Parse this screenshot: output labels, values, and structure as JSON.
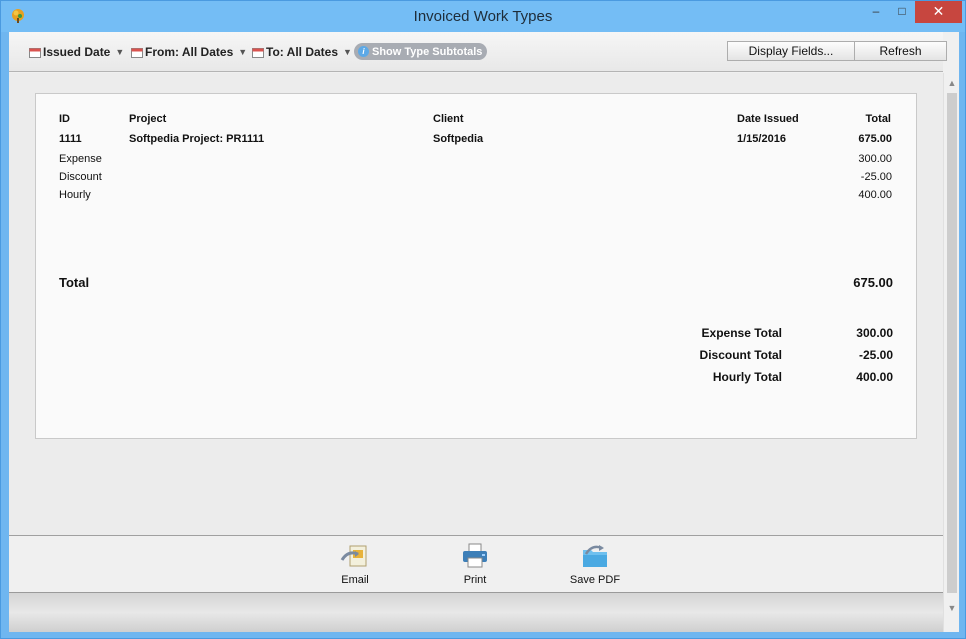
{
  "window": {
    "title": "Invoiced Work Types",
    "minimize": "–",
    "maximize": "□",
    "close": "✕"
  },
  "toolbar": {
    "filters": [
      {
        "label": "Issued Date",
        "icon": "calendar-icon"
      },
      {
        "label": "From: All Dates",
        "icon": "calendar-icon"
      },
      {
        "label": "To: All Dates",
        "icon": "calendar-icon"
      }
    ],
    "subtotals_label": "Show Type Subtotals",
    "display_fields_label": "Display Fields...",
    "refresh_label": "Refresh"
  },
  "report": {
    "headers": {
      "id": "ID",
      "project": "Project",
      "client": "Client",
      "date_issued": "Date Issued",
      "total": "Total"
    },
    "invoice": {
      "id": "1111",
      "project": "Softpedia Project: PR1111",
      "client": "Softpedia",
      "date_issued": "1/15/2016",
      "total": "675.00"
    },
    "lines": [
      {
        "type": "Expense",
        "amount": "300.00"
      },
      {
        "type": "Discount",
        "amount": "-25.00"
      },
      {
        "type": "Hourly",
        "amount": "400.00"
      }
    ],
    "grand_total_label": "Total",
    "grand_total": "675.00",
    "type_totals": [
      {
        "label": "Expense Total",
        "amount": "300.00"
      },
      {
        "label": "Discount Total",
        "amount": "-25.00"
      },
      {
        "label": "Hourly Total",
        "amount": "400.00"
      }
    ]
  },
  "actions": [
    {
      "label": "Email",
      "icon": "email-icon"
    },
    {
      "label": "Print",
      "icon": "printer-icon"
    },
    {
      "label": "Save PDF",
      "icon": "folder-icon"
    }
  ],
  "colors": {
    "title_bar": "#74bdf5",
    "close_button": "#c7463f",
    "pill": "#a8acb3"
  }
}
